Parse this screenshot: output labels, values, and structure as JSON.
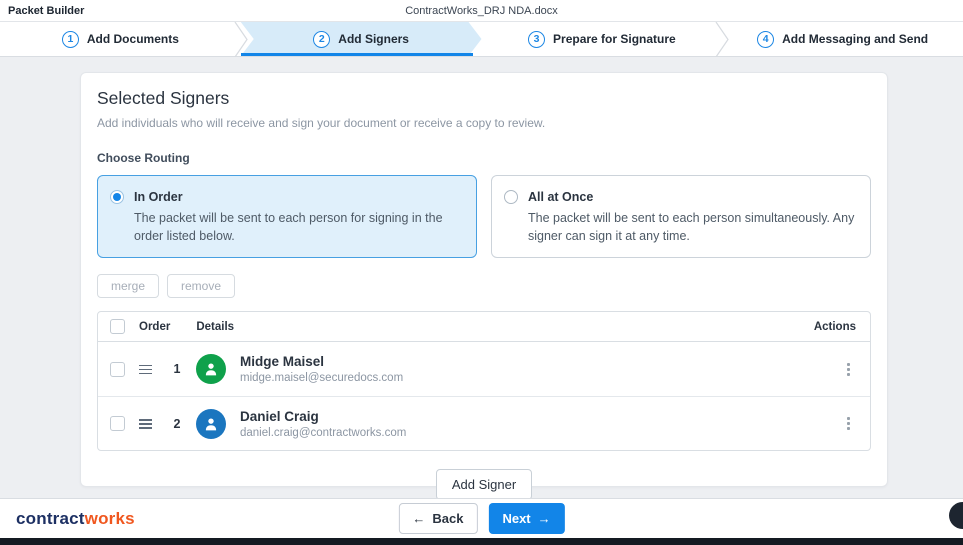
{
  "header": {
    "app_title": "Packet Builder",
    "document_name": "ContractWorks_DRJ NDA.docx"
  },
  "steps": [
    {
      "number": "1",
      "label": "Add Documents",
      "active": false
    },
    {
      "number": "2",
      "label": "Add Signers",
      "active": true
    },
    {
      "number": "3",
      "label": "Prepare for Signature",
      "active": false
    },
    {
      "number": "4",
      "label": "Add Messaging and Send",
      "active": false
    }
  ],
  "panel": {
    "title": "Selected Signers",
    "subtitle": "Add individuals who will receive and sign your document or receive a copy to review.",
    "routing_label": "Choose Routing",
    "routing_options": [
      {
        "title": "In Order",
        "description": "The packet will be sent to each person for signing in the order listed below.",
        "selected": true
      },
      {
        "title": "All at Once",
        "description": "The packet will be sent to each person simultaneously. Any signer can sign it at any time.",
        "selected": false
      }
    ],
    "bulk_actions": {
      "merge": "merge",
      "remove": "remove"
    },
    "table": {
      "headers": {
        "order": "Order",
        "details": "Details",
        "actions": "Actions"
      },
      "rows": [
        {
          "order": "1",
          "name": "Midge Maisel",
          "email": "midge.maisel@securedocs.com",
          "avatar_color": "#0fa14b"
        },
        {
          "order": "2",
          "name": "Daniel Craig",
          "email": "daniel.craig@contractworks.com",
          "avatar_color": "#1b76bf"
        }
      ]
    },
    "add_signer": "Add Signer"
  },
  "footer": {
    "logo_part1": "contract",
    "logo_part2": "works",
    "logo_part1_color": "#1d3063",
    "logo_part2_color": "#f0571f",
    "back_arrow": "←",
    "back": "Back",
    "next": "Next",
    "next_arrow": "→"
  },
  "colors": {
    "accent_blue": "#1285e8",
    "active_step_bg": "#d7ebf9",
    "selected_option_bg": "#e0f0fb",
    "selected_option_border": "#47a0e2",
    "avatar_green": "#0fa14b",
    "avatar_blue": "#1b76bf",
    "bottom_bar": "#141a22"
  }
}
